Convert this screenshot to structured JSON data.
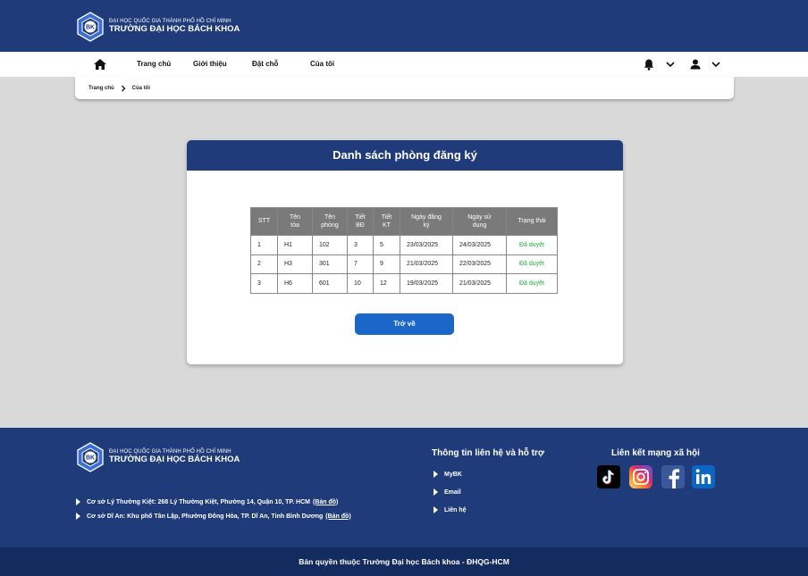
{
  "header": {
    "logo_small": "ĐẠI HỌC QUỐC GIA THÀNH PHỐ HỒ CHÍ MINH",
    "logo_big": "TRƯỜNG ĐẠI HỌC BÁCH KHOA",
    "logo_letters": "BK"
  },
  "nav": {
    "items": [
      "Trang chủ",
      "Giới thiệu",
      "Đặt chỗ",
      "Của tôi"
    ]
  },
  "breadcrumb": [
    "Trang chủ",
    "Của tôi"
  ],
  "card": {
    "title": "Danh sách phòng đăng ký",
    "columns": [
      {
        "line1": "STT",
        "line2": ""
      },
      {
        "line1": "Tên",
        "line2": "tòa"
      },
      {
        "line1": "Tên",
        "line2": "phòng"
      },
      {
        "line1": "Tiết",
        "line2": "BĐ"
      },
      {
        "line1": "Tiết",
        "line2": "KT"
      },
      {
        "line1": "Ngày đăng",
        "line2": "ký"
      },
      {
        "line1": "Ngày sử",
        "line2": "dụng"
      },
      {
        "line1": "Trạng thái",
        "line2": ""
      }
    ],
    "rows": [
      [
        "1",
        "H1",
        "102",
        "3",
        "5",
        "23/03/2025",
        "24/03/2025",
        "Đã duyệt"
      ],
      [
        "2",
        "H3",
        "301",
        "7",
        "9",
        "21/03/2025",
        "22/03/2025",
        "Đã duyệt"
      ],
      [
        "3",
        "H6",
        "601",
        "10",
        "12",
        "19/03/2025",
        "21/03/2025",
        "Đã duyệt"
      ]
    ],
    "back_button": "Trở về"
  },
  "footer": {
    "addresses": [
      {
        "text": "Cơ sở Lý Thường Kiệt: 268 Lý Thường Kiệt, Phường 14, Quận 10, TP. HCM",
        "link": "(Bản đồ)"
      },
      {
        "text": "Cơ sở Dĩ An: Khu phố Tân Lập, Phường Đông Hòa, TP. Dĩ An, Tỉnh Bình Dương",
        "link": "(Bản đồ)"
      }
    ],
    "contact_title": "Thông tin liên hệ và hỗ trợ",
    "contact_links": [
      "MyBK",
      "Email",
      "Liên hệ"
    ],
    "social_title": "Liên kết mạng xã hội",
    "social": [
      "tiktok-icon",
      "instagram-icon",
      "facebook-icon",
      "linkedin-icon"
    ],
    "copyright": "Bản quyền thuộc Trường Đại học Bách khoa - ĐHQG-HCM"
  },
  "colors": {
    "primary": "#1f3b7a",
    "button": "#1a66c9",
    "status_ok": "#1fae38",
    "background": "#d9d9d9"
  }
}
